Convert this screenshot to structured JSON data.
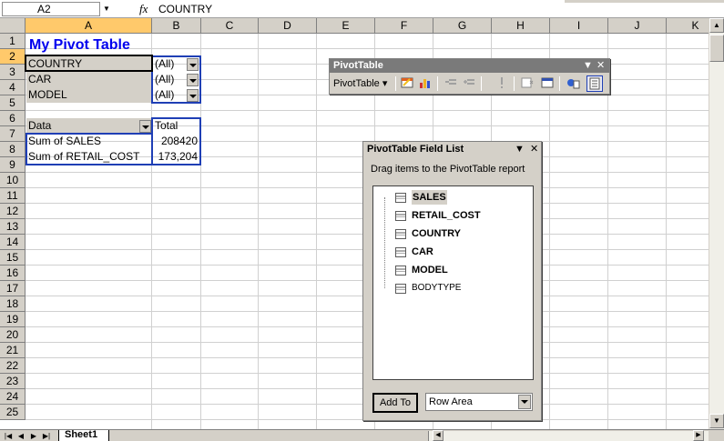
{
  "formula_bar": {
    "name_box": "A2",
    "fx": "fx",
    "value": "COUNTRY"
  },
  "columns": [
    "A",
    "B",
    "C",
    "D",
    "E",
    "F",
    "G",
    "H",
    "I",
    "J",
    "K"
  ],
  "rows": [
    "1",
    "2",
    "3",
    "4",
    "5",
    "6",
    "7",
    "8",
    "9",
    "10",
    "11",
    "12",
    "13",
    "14",
    "15",
    "16",
    "17",
    "18",
    "19",
    "20",
    "21",
    "22",
    "23",
    "24",
    "25"
  ],
  "cells": {
    "a1": "My Pivot Table",
    "a2": "COUNTRY",
    "b2": "(All)",
    "a3": "CAR",
    "b3": "(All)",
    "a4": "MODEL",
    "b4": "(All)",
    "a6": "Data",
    "b6": "Total",
    "a7": "Sum of SALES",
    "b7": "208420",
    "a8": "Sum of RETAIL_COST",
    "b8": "173,204"
  },
  "pivot_toolbar": {
    "title": "PivotTable",
    "menu_label": "PivotTable"
  },
  "field_list": {
    "title": "PivotTable Field List",
    "description": "Drag items to the PivotTable report",
    "fields": [
      "SALES",
      "RETAIL_COST",
      "COUNTRY",
      "CAR",
      "MODEL",
      "BODYTYPE"
    ],
    "add_button": "Add To",
    "area_value": "Row Area"
  },
  "sheet_tabs": [
    "Sheet1"
  ],
  "colors": {
    "title_text": "#0000ee",
    "selection_header": "#ffc96b",
    "pivot_border": "#1f3fb5",
    "chrome": "#d4d0c8"
  }
}
